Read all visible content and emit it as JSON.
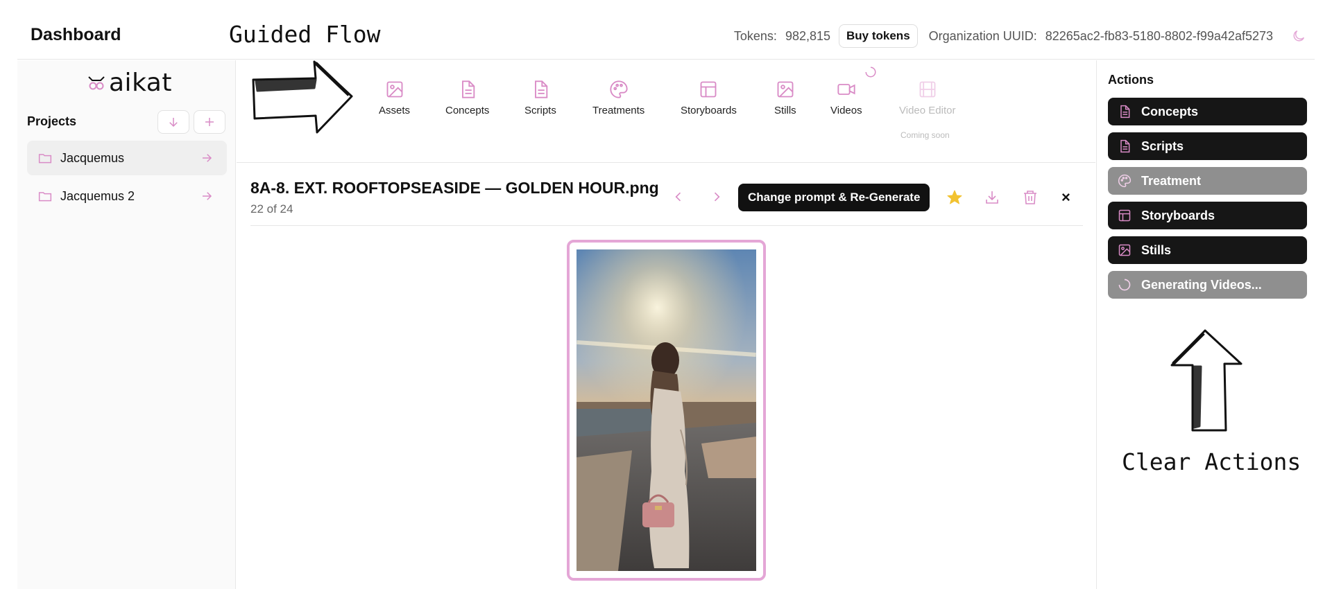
{
  "header": {
    "title": "Dashboard",
    "guided_flow": "Guided Flow",
    "tokens_label": "Tokens:",
    "tokens_value": "982,815",
    "buy_tokens": "Buy tokens",
    "uuid_label": "Organization UUID:",
    "uuid_value": "82265ac2-fb83-5180-8802-f99a42af5273"
  },
  "sidebar": {
    "logo_text": "aikat",
    "projects_label": "Projects",
    "projects": [
      {
        "name": "Jacquemus",
        "active": true
      },
      {
        "name": "Jacquemus 2",
        "active": false
      }
    ]
  },
  "toolbar": {
    "items": [
      {
        "label": "Assets",
        "icon": "image-icon"
      },
      {
        "label": "Concepts",
        "icon": "document-icon"
      },
      {
        "label": "Scripts",
        "icon": "document-icon"
      },
      {
        "label": "Treatments",
        "icon": "palette-icon"
      },
      {
        "label": "Storyboards",
        "icon": "layout-icon"
      },
      {
        "label": "Stills",
        "icon": "image-icon"
      },
      {
        "label": "Videos",
        "icon": "video-icon"
      },
      {
        "label": "Video Editor",
        "icon": "film-icon"
      }
    ],
    "coming_soon": "Coming soon"
  },
  "viewer": {
    "file_name": "8A-8. EXT. ROOFTOPSEASIDE — GOLDEN HOUR.png",
    "count": "22 of 24",
    "regenerate_label": "Change prompt & Re-Generate",
    "close_symbol": "×"
  },
  "actions": {
    "title": "Actions",
    "items": [
      {
        "label": "Concepts",
        "state": "enabled"
      },
      {
        "label": "Scripts",
        "state": "enabled"
      },
      {
        "label": "Treatment",
        "state": "disabled"
      },
      {
        "label": "Storyboards",
        "state": "enabled"
      },
      {
        "label": "Stills",
        "state": "enabled"
      },
      {
        "label": "Generating Videos...",
        "state": "loading"
      }
    ],
    "annotation": "Clear Actions"
  },
  "colors": {
    "accent_pink": "#e4a6d6",
    "icon_pink": "#d98bc6",
    "star": "#f2c230",
    "dark_button": "#161616",
    "gray_button": "#8f8f8f"
  }
}
